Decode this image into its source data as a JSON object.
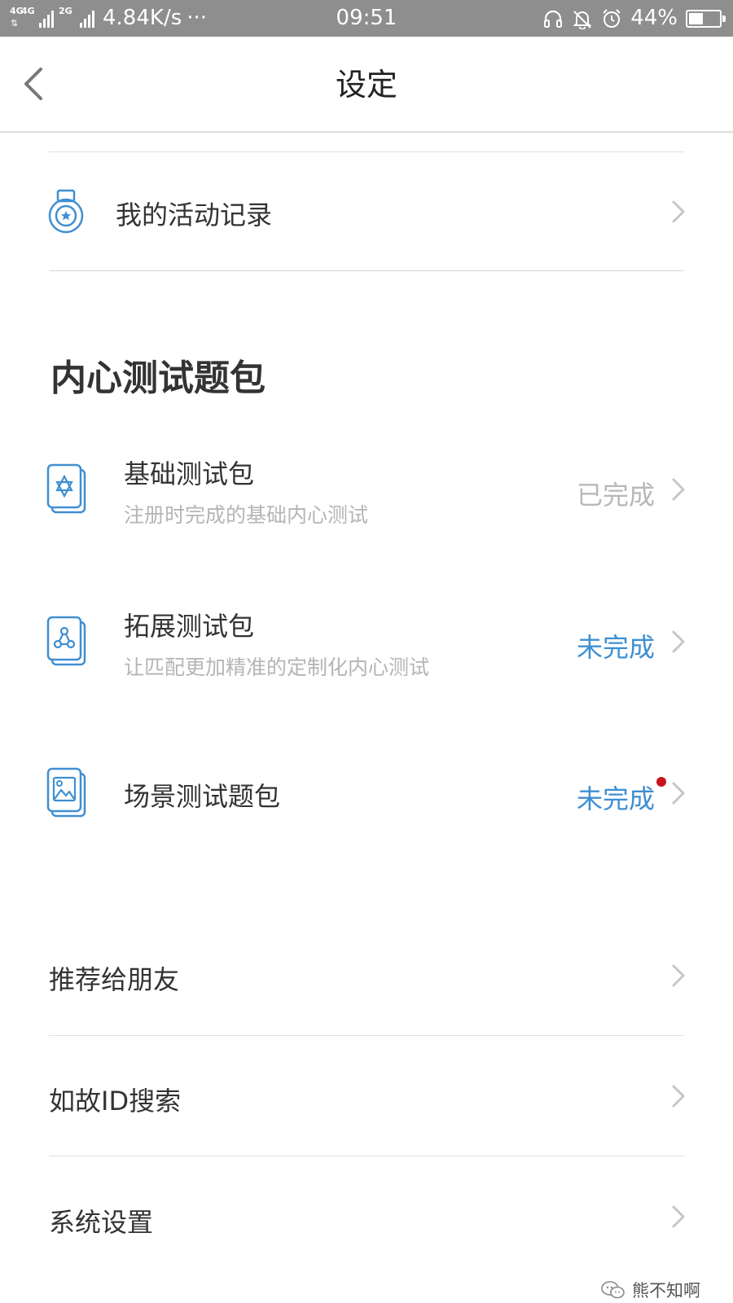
{
  "status_bar": {
    "network_1": "4G",
    "network_2": "4G",
    "network_3": "2G",
    "speed": "4.84K/s",
    "more": "···",
    "time": "09:51",
    "battery": "44%"
  },
  "nav": {
    "title": "设定"
  },
  "activity": {
    "label": "我的活动记录"
  },
  "test_section": {
    "title": "内心测试题包",
    "items": [
      {
        "title": "基础测试包",
        "subtitle": "注册时完成的基础内心测试",
        "status": "已完成"
      },
      {
        "title": "拓展测试包",
        "subtitle": "让匹配更加精准的定制化内心测试",
        "status": "未完成"
      },
      {
        "title": "场景测试题包",
        "status": "未完成"
      }
    ]
  },
  "menu": {
    "items": [
      {
        "label": "推荐给朋友"
      },
      {
        "label": "如故ID搜索"
      },
      {
        "label": "系统设置"
      }
    ]
  },
  "watermark": {
    "text": "熊不知啊"
  },
  "colors": {
    "accent": "#3f8fd2",
    "status_bar": "#8e8e8e",
    "notification_dot": "#c8141e",
    "muted_text": "#b5b5b5"
  },
  "icons": {
    "back": "chevron-left-icon",
    "activity": "medal-icon",
    "basic_pack": "star-card-icon",
    "extended_pack": "network-card-icon",
    "scene_pack": "image-card-icon",
    "row_arrow": "chevron-right-icon"
  }
}
